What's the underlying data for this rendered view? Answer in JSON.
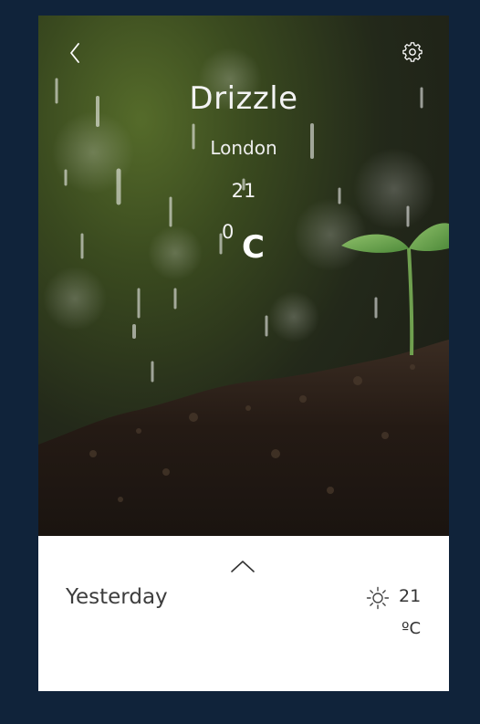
{
  "weather": {
    "condition": "Drizzle",
    "city": "London",
    "temperature": "21",
    "degree_mark": "0",
    "unit": "C"
  },
  "forecast": {
    "day_label": "Yesterday",
    "temperature": "21",
    "unit": "ºC",
    "icon": "sun-icon"
  },
  "icons": {
    "back": "chevron-left-icon",
    "settings": "gear-icon",
    "expand": "chevron-up-icon"
  },
  "colors": {
    "page_background": "#10233a",
    "panel_background": "#ffffff",
    "hero_text": "#f3f3f3",
    "panel_text": "#3d3d3d"
  }
}
